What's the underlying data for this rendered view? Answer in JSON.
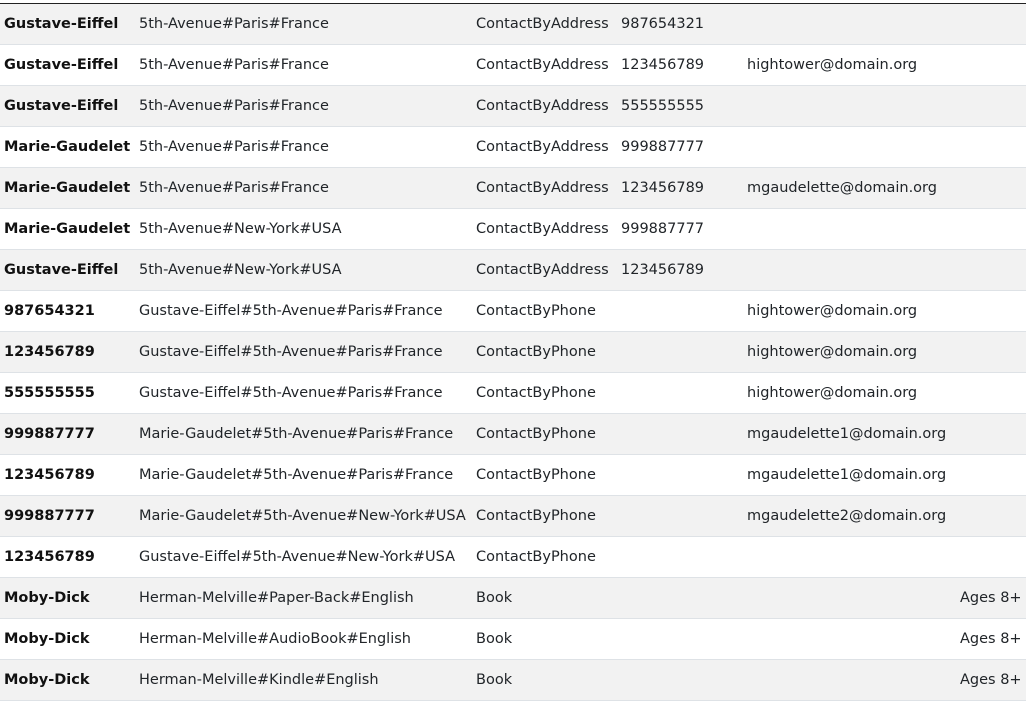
{
  "table": {
    "rows": [
      {
        "key": "Gustave-Eiffel",
        "value": "5th-Avenue#Paris#France",
        "type": "ContactByAddress",
        "phone": "987654321",
        "email": "",
        "extra": ""
      },
      {
        "key": "Gustave-Eiffel",
        "value": "5th-Avenue#Paris#France",
        "type": "ContactByAddress",
        "phone": "123456789",
        "email": "hightower@domain.org",
        "extra": ""
      },
      {
        "key": "Gustave-Eiffel",
        "value": "5th-Avenue#Paris#France",
        "type": "ContactByAddress",
        "phone": "555555555",
        "email": "",
        "extra": ""
      },
      {
        "key": "Marie-Gaudelet",
        "value": "5th-Avenue#Paris#France",
        "type": "ContactByAddress",
        "phone": "999887777",
        "email": "",
        "extra": ""
      },
      {
        "key": "Marie-Gaudelet",
        "value": "5th-Avenue#Paris#France",
        "type": "ContactByAddress",
        "phone": "123456789",
        "email": "mgaudelette@domain.org",
        "extra": ""
      },
      {
        "key": "Marie-Gaudelet",
        "value": "5th-Avenue#New-York#USA",
        "type": "ContactByAddress",
        "phone": "999887777",
        "email": "",
        "extra": ""
      },
      {
        "key": "Gustave-Eiffel",
        "value": "5th-Avenue#New-York#USA",
        "type": "ContactByAddress",
        "phone": "123456789",
        "email": "",
        "extra": ""
      },
      {
        "key": "987654321",
        "value": "Gustave-Eiffel#5th-Avenue#Paris#France",
        "type": "ContactByPhone",
        "phone": "",
        "email": "hightower@domain.org",
        "extra": ""
      },
      {
        "key": "123456789",
        "value": "Gustave-Eiffel#5th-Avenue#Paris#France",
        "type": "ContactByPhone",
        "phone": "",
        "email": "hightower@domain.org",
        "extra": ""
      },
      {
        "key": "555555555",
        "value": "Gustave-Eiffel#5th-Avenue#Paris#France",
        "type": "ContactByPhone",
        "phone": "",
        "email": "hightower@domain.org",
        "extra": ""
      },
      {
        "key": "999887777",
        "value": "Marie-Gaudelet#5th-Avenue#Paris#France",
        "type": "ContactByPhone",
        "phone": "",
        "email": "mgaudelette1@domain.org",
        "extra": ""
      },
      {
        "key": "123456789",
        "value": "Marie-Gaudelet#5th-Avenue#Paris#France",
        "type": "ContactByPhone",
        "phone": "",
        "email": "mgaudelette1@domain.org",
        "extra": ""
      },
      {
        "key": "999887777",
        "value": "Marie-Gaudelet#5th-Avenue#New-York#USA",
        "type": "ContactByPhone",
        "phone": "",
        "email": "mgaudelette2@domain.org",
        "extra": ""
      },
      {
        "key": "123456789",
        "value": "Gustave-Eiffel#5th-Avenue#New-York#USA",
        "type": "ContactByPhone",
        "phone": "",
        "email": "",
        "extra": ""
      },
      {
        "key": "Moby-Dick",
        "value": "Herman-Melville#Paper-Back#English",
        "type": "Book",
        "phone": "",
        "email": "",
        "extra": "Ages 8+"
      },
      {
        "key": "Moby-Dick",
        "value": "Herman-Melville#AudioBook#English",
        "type": "Book",
        "phone": "",
        "email": "",
        "extra": "Ages 8+"
      },
      {
        "key": "Moby-Dick",
        "value": "Herman-Melville#Kindle#English",
        "type": "Book",
        "phone": "",
        "email": "",
        "extra": "Ages 8+"
      }
    ]
  }
}
